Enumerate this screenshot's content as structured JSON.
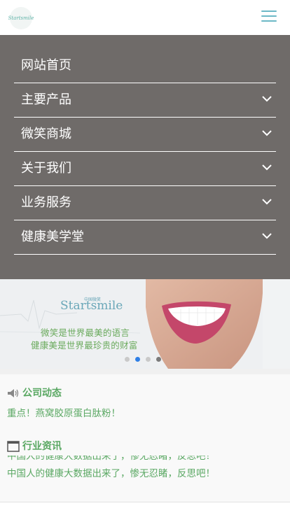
{
  "header": {
    "logo_text": "Startsmile",
    "menu_icon": "hamburger-icon",
    "accent_color": "#6cb8c6"
  },
  "nav": {
    "background": "#6f6b69",
    "items": [
      {
        "label": "网站首页",
        "has_submenu": false
      },
      {
        "label": "主要产品",
        "has_submenu": true
      },
      {
        "label": "微笑商城",
        "has_submenu": true
      },
      {
        "label": "关于我们",
        "has_submenu": true
      },
      {
        "label": "业务服务",
        "has_submenu": true
      },
      {
        "label": "健康美学堂",
        "has_submenu": true
      }
    ],
    "submenu_icon": "chevron-down-icon"
  },
  "banner": {
    "brand": "Startsmile",
    "brand_small": "中国微笑",
    "line1": "微笑是世界最美的语言",
    "line2": "健康美是世界最珍贵的财富",
    "slide_count": 4,
    "active_slide": 2
  },
  "sections": {
    "company": {
      "title": "公司动态",
      "icon": "speaker-icon",
      "items": [
        "重点！燕窝胶原蛋白肽粉！"
      ]
    },
    "industry": {
      "title": "行业资讯",
      "icon": "window-icon",
      "items": [
        "中国人的健康大数据出来了，惨无忍睹，反思吧！"
      ]
    },
    "text_color": "#5aa863"
  }
}
